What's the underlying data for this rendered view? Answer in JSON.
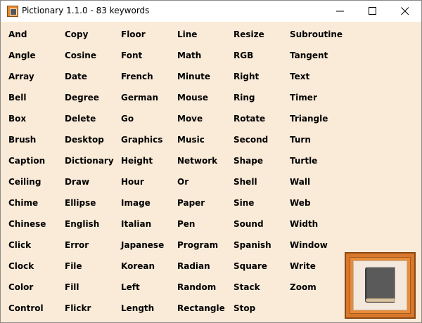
{
  "window": {
    "title": "Pictionary 1.1.0 - 83 keywords",
    "controls": [
      "minimize",
      "maximize",
      "close"
    ]
  },
  "colors": {
    "background": "#faebd8",
    "frame": "#d9772a",
    "book": "#5a5a5a"
  },
  "keywords": {
    "col1": [
      "And",
      "Angle",
      "Array",
      "Bell",
      "Box",
      "Brush",
      "Caption",
      "Ceiling",
      "Chime",
      "Chinese",
      "Click",
      "Clock",
      "Color",
      "Control"
    ],
    "col2": [
      "Copy",
      "Cosine",
      "Date",
      "Degree",
      "Delete",
      "Desktop",
      "Dictionary",
      "Draw",
      "Ellipse",
      "English",
      "Error",
      "File",
      "Fill",
      "Flickr"
    ],
    "col3": [
      "Floor",
      "Font",
      "French",
      "German",
      "Go",
      "Graphics",
      "Height",
      "Hour",
      "Image",
      "Italian",
      "Japanese",
      "Korean",
      "Left",
      "Length"
    ],
    "col4": [
      "Line",
      "Math",
      "Minute",
      "Mouse",
      "Move",
      "Music",
      "Network",
      "Or",
      "Paper",
      "Pen",
      "Program",
      "Radian",
      "Random",
      "Rectangle"
    ],
    "col5": [
      "Resize",
      "RGB",
      "Right",
      "Ring",
      "Rotate",
      "Second",
      "Shape",
      "Shell",
      "Sine",
      "Sound",
      "Spanish",
      "Square",
      "Stack",
      "Stop"
    ],
    "col6": [
      "Subroutine",
      "Tangent",
      "Text",
      "Timer",
      "Triangle",
      "Turn",
      "Turtle",
      "Wall",
      "Web",
      "Width",
      "Window",
      "Write",
      "Zoom"
    ]
  },
  "picture": {
    "icon": "book-icon"
  }
}
